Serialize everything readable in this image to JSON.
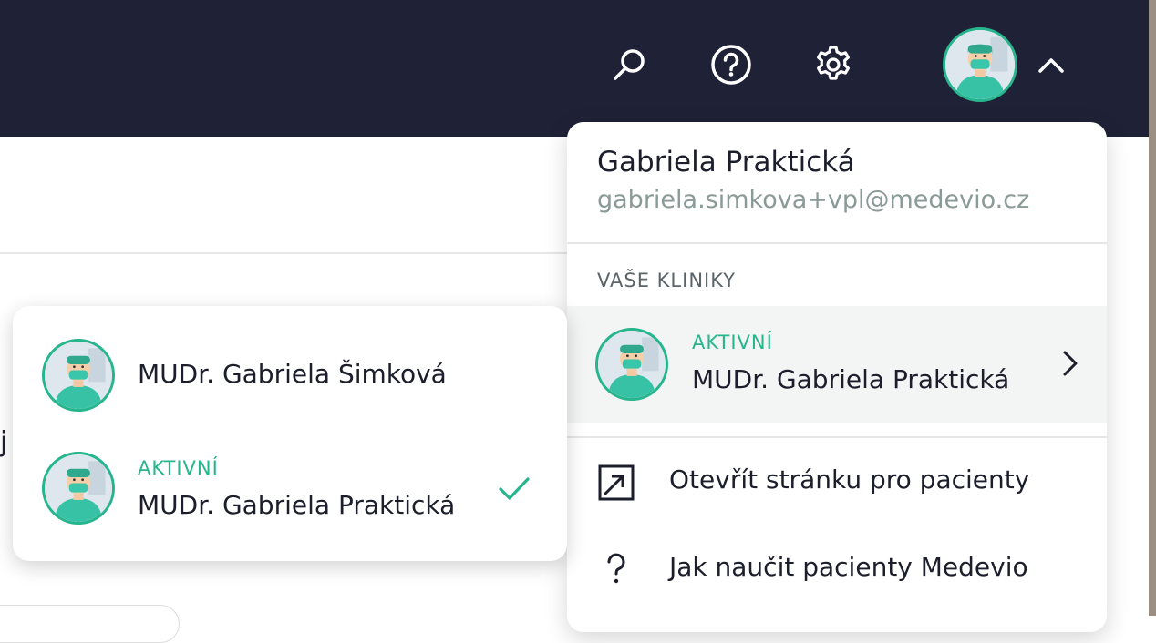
{
  "topbar": {
    "icons": [
      "search-icon",
      "help-circle-icon",
      "gear-icon",
      "chevron-up-icon"
    ]
  },
  "user": {
    "name": "Gabriela Praktická",
    "email": "gabriela.simkova+vpl@medevio.cz"
  },
  "clinics_section": {
    "heading": "VAŠE KLINIKY",
    "active_status": "AKTIVNÍ",
    "active_clinic": "MUDr. Gabriela Praktická"
  },
  "menu_items": [
    {
      "label": "Otevřít stránku pro pacienty",
      "icon": "external-link-icon"
    },
    {
      "label": "Jak naučit pacienty Medevio",
      "icon": "question-mark-icon"
    }
  ],
  "clinic_picker": {
    "items": [
      {
        "name": "MUDr. Gabriela Šimková",
        "status": ""
      },
      {
        "name": "MUDr. Gabriela Praktická",
        "status": "AKTIVNÍ",
        "selected": true
      }
    ]
  },
  "background": {
    "partial_text": "j"
  },
  "colors": {
    "topbar": "#1f2137",
    "accent": "#26b58c",
    "email_text": "#8a9a97",
    "row_highlight": "#f3f4f4"
  }
}
